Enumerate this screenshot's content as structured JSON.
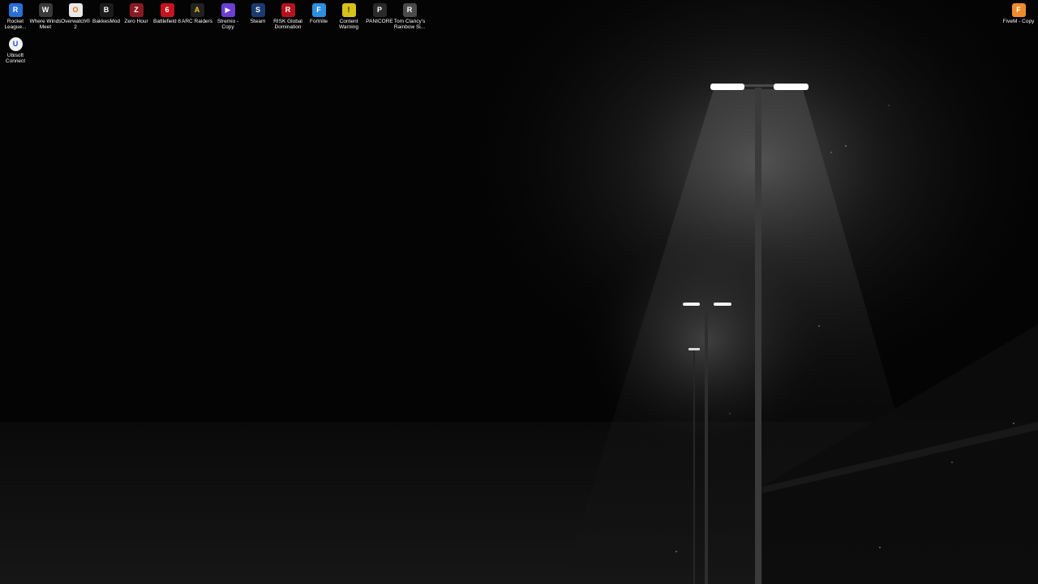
{
  "desktop": {
    "icons_row1": [
      {
        "label": "Rocket League...",
        "icon": "rocket-league-icon",
        "color": "#2a6fd6",
        "glyph": "R"
      },
      {
        "label": "Where Winds Meet",
        "icon": "where-winds-meet-icon",
        "color": "#3a3a3a",
        "glyph": "W"
      },
      {
        "label": "Overwatch® 2",
        "icon": "overwatch-icon",
        "color": "#e8e8e8",
        "glyph": "O"
      },
      {
        "label": "BakkesMod",
        "icon": "bakkesmod-icon",
        "color": "#1c1c1c",
        "glyph": "B"
      },
      {
        "label": "Zero Hour",
        "icon": "zero-hour-icon",
        "color": "#8a1a22",
        "glyph": "Z"
      },
      {
        "label": "Battlefield 6",
        "icon": "battlefield-icon",
        "color": "#c8141e",
        "glyph": "6"
      },
      {
        "label": "ARC Raiders",
        "icon": "arc-raiders-icon",
        "color": "#222222",
        "glyph": "A"
      },
      {
        "label": "Stremio - Copy",
        "icon": "stremio-icon",
        "color": "#6b3fd4",
        "glyph": "▶"
      },
      {
        "label": "Steam",
        "icon": "steam-icon",
        "color": "#1b3b6f",
        "glyph": "S"
      },
      {
        "label": "RISK Global Domination",
        "icon": "risk-icon",
        "color": "#b5121b",
        "glyph": "R"
      },
      {
        "label": "Fortnite",
        "icon": "fortnite-icon",
        "color": "#2d8fe0",
        "glyph": "F"
      },
      {
        "label": "Content Warning",
        "icon": "content-warning-icon",
        "color": "#d8c21a",
        "glyph": "!"
      },
      {
        "label": "PANICORE",
        "icon": "panicore-icon",
        "color": "#2a2a2a",
        "glyph": "P"
      },
      {
        "label": "Tom Clancy's Rainbow Si...",
        "icon": "rainbow-six-icon",
        "color": "#4a4a4a",
        "glyph": "R"
      }
    ],
    "icons_row2": [
      {
        "label": "Ubisoft Connect",
        "icon": "ubisoft-connect-icon",
        "color": "#f2f2f2",
        "glyph": "U"
      }
    ],
    "icons_right": [
      {
        "label": "FiveM - Copy",
        "icon": "fivem-icon",
        "color": "#f08a2c",
        "glyph": "F"
      }
    ]
  }
}
